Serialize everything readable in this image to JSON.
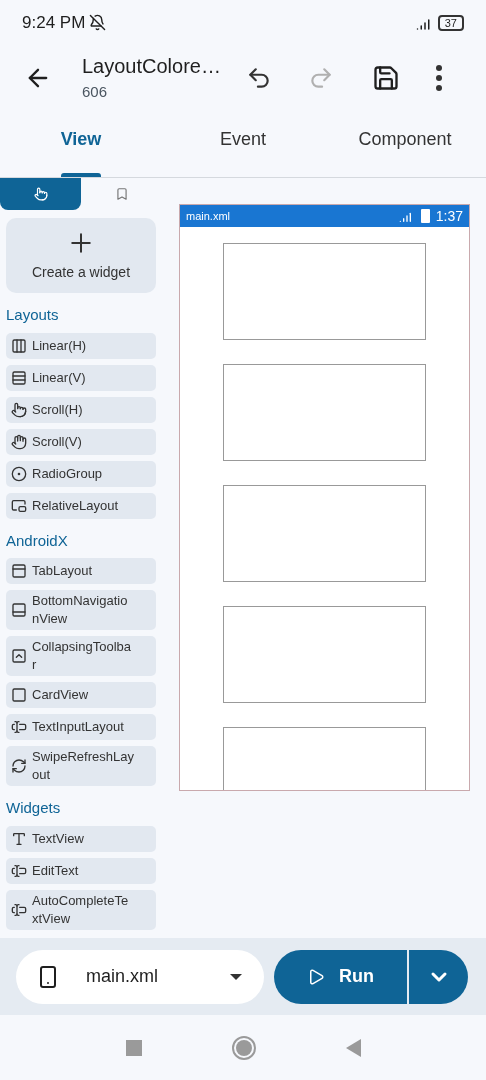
{
  "status_bar": {
    "time": "9:24 PM",
    "battery": "37"
  },
  "app_bar": {
    "title": "LayoutColore…",
    "subtitle": "606",
    "undo_disabled": false,
    "redo_disabled": true
  },
  "tabs": [
    {
      "label": "View",
      "selected": true
    },
    {
      "label": "Event",
      "selected": false
    },
    {
      "label": "Component",
      "selected": false
    }
  ],
  "palette_tabs": [
    {
      "selected": true
    },
    {
      "selected": false
    }
  ],
  "create_widget": "Create a widget",
  "sections": [
    {
      "title": "Layouts",
      "items": [
        "Linear(H)",
        "Linear(V)",
        "Scroll(H)",
        "Scroll(V)",
        "RadioGroup",
        "RelativeLayout"
      ]
    },
    {
      "title": "AndroidX",
      "items": [
        "TabLayout",
        "BottomNavigationView",
        "CollapsingToolbar",
        "CardView",
        "TextInputLayout",
        "SwipeRefreshLayout"
      ]
    },
    {
      "title": "Widgets",
      "items": [
        "TextView",
        "EditText",
        "AutoCompleteTextView"
      ]
    }
  ],
  "preview": {
    "file": "main.xml",
    "time": "1:37"
  },
  "bottom_bar": {
    "file": "main.xml",
    "run": "Run"
  }
}
